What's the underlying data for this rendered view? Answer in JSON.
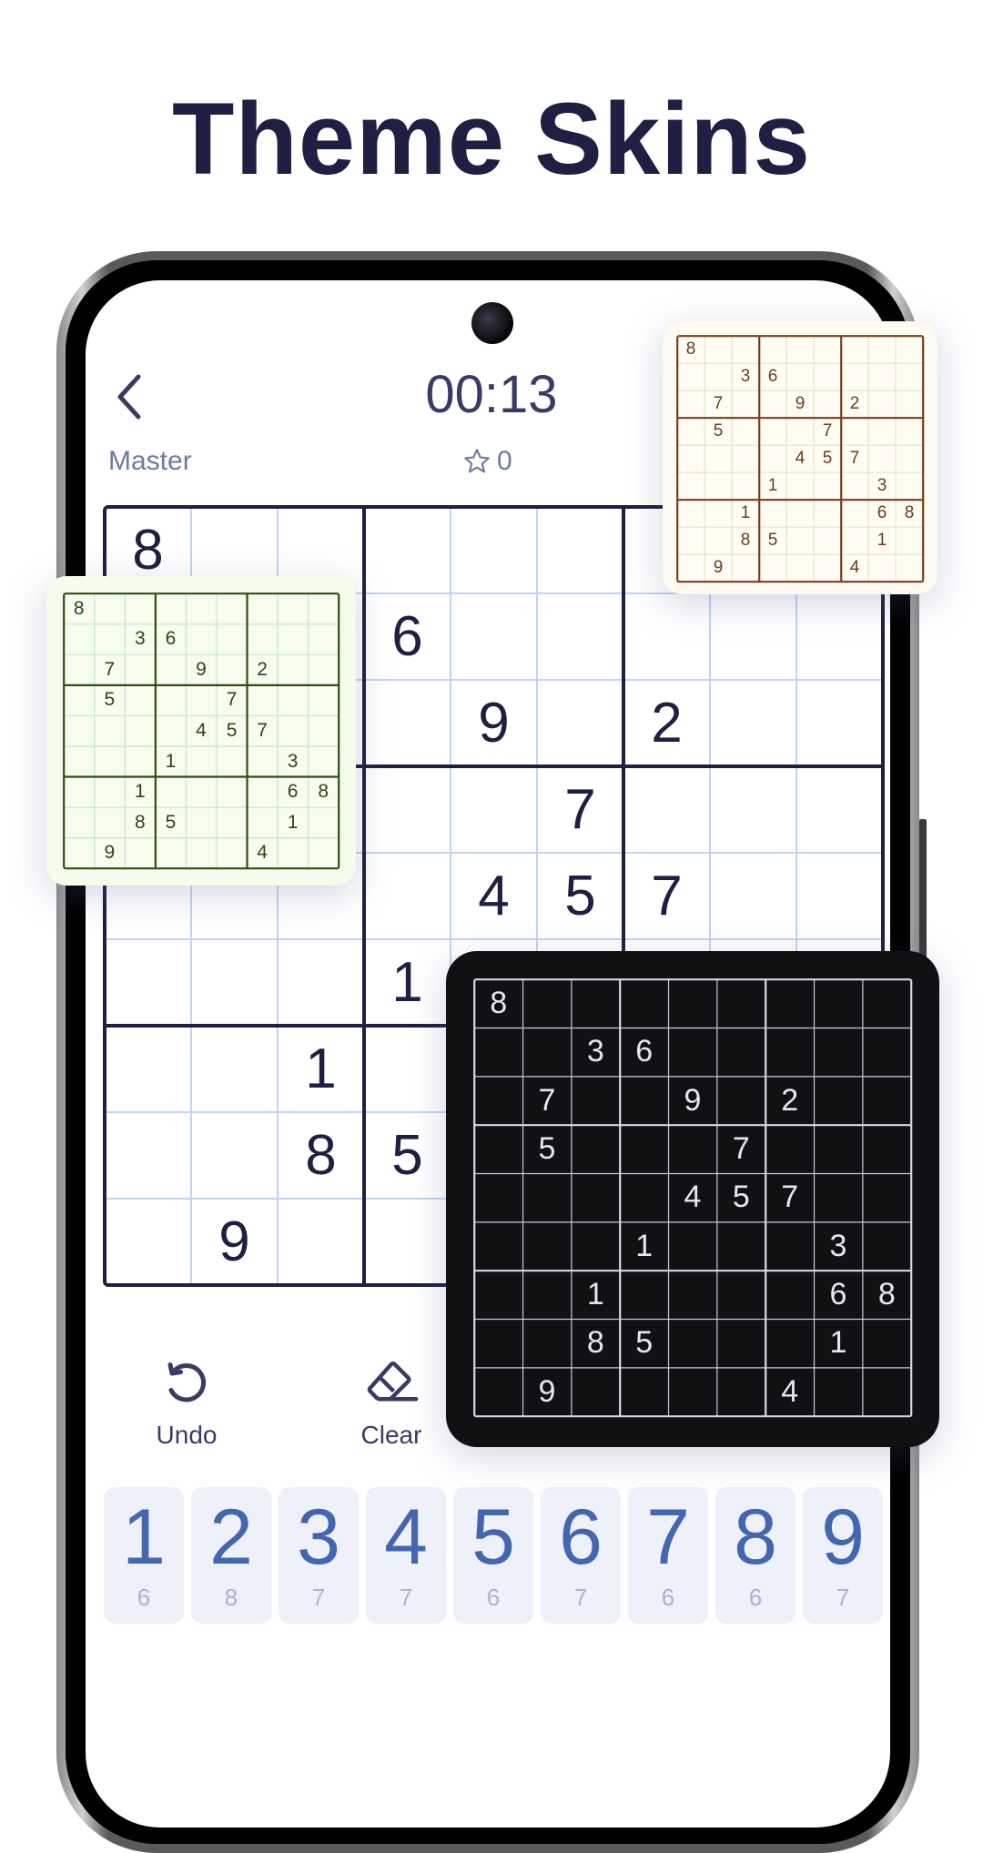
{
  "headline": "Theme Skins",
  "game": {
    "timer": "00:13",
    "difficulty": "Master",
    "score": "0",
    "icons": {
      "back": "chevron-left-icon",
      "score": "star-icon"
    }
  },
  "puzzle": [
    [
      8,
      0,
      0,
      0,
      0,
      0,
      0,
      0,
      0
    ],
    [
      0,
      0,
      3,
      6,
      0,
      0,
      0,
      0,
      0
    ],
    [
      0,
      7,
      0,
      0,
      9,
      0,
      2,
      0,
      0
    ],
    [
      0,
      5,
      0,
      0,
      0,
      7,
      0,
      0,
      0
    ],
    [
      0,
      0,
      0,
      0,
      4,
      5,
      7,
      0,
      0
    ],
    [
      0,
      0,
      0,
      1,
      0,
      0,
      0,
      3,
      0
    ],
    [
      0,
      0,
      1,
      0,
      0,
      0,
      0,
      6,
      8
    ],
    [
      0,
      0,
      8,
      5,
      0,
      0,
      0,
      1,
      0
    ],
    [
      0,
      9,
      0,
      0,
      0,
      0,
      4,
      0,
      0
    ]
  ],
  "tools": [
    {
      "label": "Undo",
      "icon": "undo-icon"
    },
    {
      "label": "Clear",
      "icon": "eraser-icon"
    }
  ],
  "numpad": [
    {
      "digit": "1",
      "remaining": "6"
    },
    {
      "digit": "2",
      "remaining": "8"
    },
    {
      "digit": "3",
      "remaining": "7"
    },
    {
      "digit": "4",
      "remaining": "7"
    },
    {
      "digit": "5",
      "remaining": "6"
    },
    {
      "digit": "6",
      "remaining": "7"
    },
    {
      "digit": "7",
      "remaining": "6"
    },
    {
      "digit": "8",
      "remaining": "6"
    },
    {
      "digit": "9",
      "remaining": "7"
    }
  ],
  "skins": [
    {
      "name": "cream",
      "card": "#fdfbf1",
      "bg": "#fffdf3",
      "thin": "#e6e2c8",
      "thick": "#7a3d1c",
      "digit": "#6a3b20"
    },
    {
      "name": "mint",
      "card": "#f4fcec",
      "bg": "#f6fdef",
      "thin": "#c8e4d2",
      "thick": "#2f4d12",
      "digit": "#2f4416"
    },
    {
      "name": "dark",
      "card": "#111114",
      "bg": "#111114",
      "thin": "#c9c9d2",
      "thick": "#d8d8e0",
      "digit": "#e6e6ee"
    }
  ],
  "colors": {
    "board_thick": "#1f1f44",
    "board_thin": "#c3d3f0",
    "accent": "#4266b0"
  }
}
